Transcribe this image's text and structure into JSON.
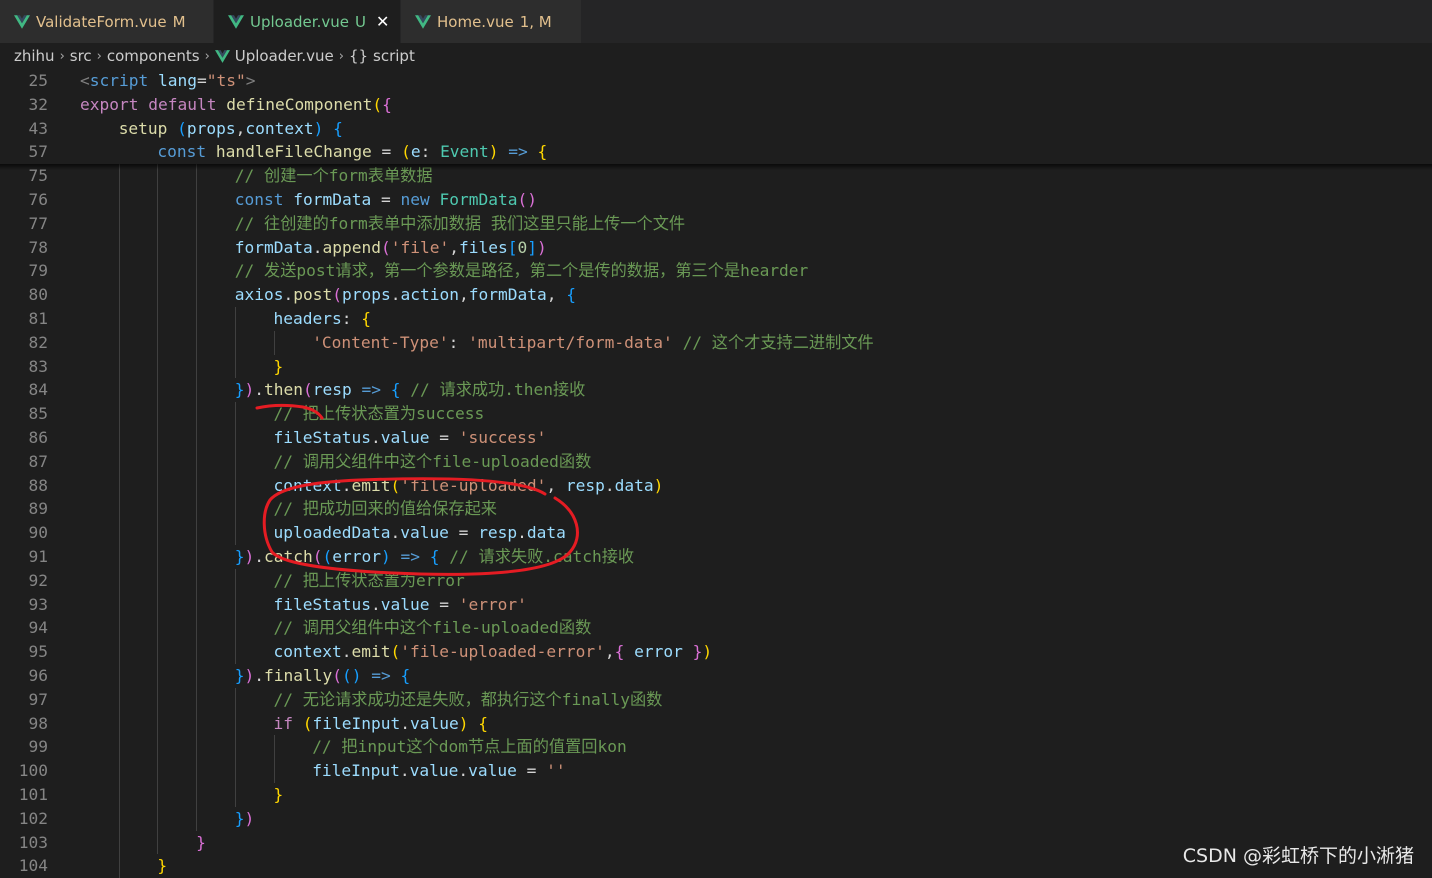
{
  "tabs": [
    {
      "name": "ValidateForm.vue",
      "status": "M",
      "name_color": "#e2c08d",
      "status_color": "#e2c08d",
      "active": false
    },
    {
      "name": "Uploader.vue",
      "status": "U",
      "name_color": "#73c991",
      "status_color": "#73c991",
      "active": true,
      "close": "✕"
    },
    {
      "name": "Home.vue",
      "status": "1, M",
      "name_color": "#e2c08d",
      "status_color": "#e2c08d",
      "active": false
    }
  ],
  "breadcrumb": {
    "items": [
      "zhihu",
      "src",
      "components",
      "Uploader.vue",
      "script"
    ],
    "separator": "›",
    "braces": "{}"
  },
  "sticky_lines": [
    {
      "ln": "25",
      "indent": 0,
      "tokens": [
        [
          "tag",
          "<"
        ],
        [
          "kw",
          "script"
        ],
        [
          "pun",
          " "
        ],
        [
          "var",
          "lang"
        ],
        [
          "pun",
          "="
        ],
        [
          "str",
          "\"ts\""
        ],
        [
          "tag",
          ">"
        ]
      ]
    },
    {
      "ln": "32",
      "indent": 0,
      "tokens": [
        [
          "ctl",
          "export"
        ],
        [
          "pun",
          " "
        ],
        [
          "ctl",
          "default"
        ],
        [
          "pun",
          " "
        ],
        [
          "fn",
          "defineComponent"
        ],
        [
          "b1",
          "("
        ],
        [
          "b2",
          "{"
        ]
      ]
    },
    {
      "ln": "43",
      "indent": 1,
      "tokens": [
        [
          "fn",
          "setup"
        ],
        [
          "pun",
          " "
        ],
        [
          "b3",
          "("
        ],
        [
          "var",
          "props"
        ],
        [
          "pun",
          ","
        ],
        [
          "var",
          "context"
        ],
        [
          "b3",
          ")"
        ],
        [
          "pun",
          " "
        ],
        [
          "b3",
          "{"
        ]
      ]
    },
    {
      "ln": "57",
      "indent": 2,
      "tokens": [
        [
          "kw",
          "const"
        ],
        [
          "pun",
          " "
        ],
        [
          "fn",
          "handleFileChange"
        ],
        [
          "pun",
          " = "
        ],
        [
          "b1",
          "("
        ],
        [
          "var",
          "e"
        ],
        [
          "pun",
          ": "
        ],
        [
          "cls",
          "Event"
        ],
        [
          "b1",
          ")"
        ],
        [
          "pun",
          " "
        ],
        [
          "kw",
          "=>"
        ],
        [
          "pun",
          " "
        ],
        [
          "b1",
          "{"
        ]
      ]
    }
  ],
  "code_lines": [
    {
      "ln": "75",
      "indent": 4,
      "tokens": [
        [
          "cmt",
          "// 创建一个form表单数据"
        ]
      ]
    },
    {
      "ln": "76",
      "indent": 4,
      "tokens": [
        [
          "kw",
          "const"
        ],
        [
          "pun",
          " "
        ],
        [
          "var",
          "formData"
        ],
        [
          "pun",
          " = "
        ],
        [
          "kw",
          "new"
        ],
        [
          "pun",
          " "
        ],
        [
          "cls",
          "FormData"
        ],
        [
          "b2",
          "()"
        ]
      ]
    },
    {
      "ln": "77",
      "indent": 4,
      "tokens": [
        [
          "cmt",
          "// 往创建的form表单中添加数据 我们这里只能上传一个文件"
        ]
      ]
    },
    {
      "ln": "78",
      "indent": 4,
      "tokens": [
        [
          "var",
          "formData"
        ],
        [
          "pun",
          "."
        ],
        [
          "fn",
          "append"
        ],
        [
          "b2",
          "("
        ],
        [
          "str",
          "'file'"
        ],
        [
          "pun",
          ","
        ],
        [
          "var",
          "files"
        ],
        [
          "b3",
          "["
        ],
        [
          "num",
          "0"
        ],
        [
          "b3",
          "]"
        ],
        [
          "b2",
          ")"
        ]
      ]
    },
    {
      "ln": "79",
      "indent": 4,
      "tokens": [
        [
          "cmt",
          "// 发送post请求，第一个参数是路径，第二个是传的数据，第三个是hearder"
        ]
      ]
    },
    {
      "ln": "80",
      "indent": 4,
      "tokens": [
        [
          "var",
          "axios"
        ],
        [
          "pun",
          "."
        ],
        [
          "fn",
          "post"
        ],
        [
          "b2",
          "("
        ],
        [
          "var",
          "props"
        ],
        [
          "pun",
          "."
        ],
        [
          "var",
          "action"
        ],
        [
          "pun",
          ","
        ],
        [
          "var",
          "formData"
        ],
        [
          "pun",
          ", "
        ],
        [
          "b3",
          "{"
        ]
      ]
    },
    {
      "ln": "81",
      "indent": 5,
      "tokens": [
        [
          "var",
          "headers"
        ],
        [
          "pun",
          ": "
        ],
        [
          "b1",
          "{"
        ]
      ]
    },
    {
      "ln": "82",
      "indent": 6,
      "tokens": [
        [
          "str",
          "'Content-Type'"
        ],
        [
          "pun",
          ": "
        ],
        [
          "str",
          "'multipart/form-data'"
        ],
        [
          "pun",
          " "
        ],
        [
          "cmt",
          "// 这个才支持二进制文件"
        ]
      ]
    },
    {
      "ln": "83",
      "indent": 5,
      "tokens": [
        [
          "b1",
          "}"
        ]
      ]
    },
    {
      "ln": "84",
      "indent": 4,
      "tokens": [
        [
          "b3",
          "}"
        ],
        [
          "b2",
          ")"
        ],
        [
          "pun",
          "."
        ],
        [
          "fn",
          "then"
        ],
        [
          "b2",
          "("
        ],
        [
          "var",
          "resp"
        ],
        [
          "pun",
          " "
        ],
        [
          "kw",
          "=>"
        ],
        [
          "pun",
          " "
        ],
        [
          "b3",
          "{"
        ],
        [
          "pun",
          " "
        ],
        [
          "cmt",
          "// 请求成功.then接收"
        ]
      ]
    },
    {
      "ln": "85",
      "indent": 5,
      "tokens": [
        [
          "cmt",
          "// 把上传状态置为success"
        ]
      ]
    },
    {
      "ln": "86",
      "indent": 5,
      "tokens": [
        [
          "var",
          "fileStatus"
        ],
        [
          "pun",
          "."
        ],
        [
          "var",
          "value"
        ],
        [
          "pun",
          " = "
        ],
        [
          "str",
          "'success'"
        ]
      ]
    },
    {
      "ln": "87",
      "indent": 5,
      "tokens": [
        [
          "cmt",
          "// 调用父组件中这个file-uploaded函数"
        ]
      ]
    },
    {
      "ln": "88",
      "indent": 5,
      "tokens": [
        [
          "var",
          "context"
        ],
        [
          "pun",
          "."
        ],
        [
          "fn",
          "emit"
        ],
        [
          "b1",
          "("
        ],
        [
          "str",
          "'file-uploaded'"
        ],
        [
          "pun",
          ", "
        ],
        [
          "var",
          "resp"
        ],
        [
          "pun",
          "."
        ],
        [
          "var",
          "data"
        ],
        [
          "b1",
          ")"
        ]
      ]
    },
    {
      "ln": "89",
      "indent": 5,
      "tokens": [
        [
          "cmt",
          "// 把成功回来的值给保存起来"
        ]
      ]
    },
    {
      "ln": "90",
      "indent": 5,
      "tokens": [
        [
          "var",
          "uploadedData"
        ],
        [
          "pun",
          "."
        ],
        [
          "var",
          "value"
        ],
        [
          "pun",
          " = "
        ],
        [
          "var",
          "resp"
        ],
        [
          "pun",
          "."
        ],
        [
          "var",
          "data"
        ]
      ]
    },
    {
      "ln": "91",
      "indent": 4,
      "tokens": [
        [
          "b3",
          "}"
        ],
        [
          "b2",
          ")"
        ],
        [
          "pun",
          "."
        ],
        [
          "fn",
          "catch"
        ],
        [
          "b2",
          "("
        ],
        [
          "b3",
          "("
        ],
        [
          "var",
          "error"
        ],
        [
          "b3",
          ")"
        ],
        [
          "pun",
          " "
        ],
        [
          "kw",
          "=>"
        ],
        [
          "pun",
          " "
        ],
        [
          "b3",
          "{"
        ],
        [
          "pun",
          " "
        ],
        [
          "cmt",
          "// 请求失败.catch接收"
        ]
      ]
    },
    {
      "ln": "92",
      "indent": 5,
      "tokens": [
        [
          "cmt",
          "// 把上传状态置为error"
        ]
      ]
    },
    {
      "ln": "93",
      "indent": 5,
      "tokens": [
        [
          "var",
          "fileStatus"
        ],
        [
          "pun",
          "."
        ],
        [
          "var",
          "value"
        ],
        [
          "pun",
          " = "
        ],
        [
          "str",
          "'error'"
        ]
      ]
    },
    {
      "ln": "94",
      "indent": 5,
      "tokens": [
        [
          "cmt",
          "// 调用父组件中这个file-uploaded函数"
        ]
      ]
    },
    {
      "ln": "95",
      "indent": 5,
      "tokens": [
        [
          "var",
          "context"
        ],
        [
          "pun",
          "."
        ],
        [
          "fn",
          "emit"
        ],
        [
          "b1",
          "("
        ],
        [
          "str",
          "'file-uploaded-error'"
        ],
        [
          "pun",
          ","
        ],
        [
          "b2",
          "{"
        ],
        [
          "pun",
          " "
        ],
        [
          "var",
          "error"
        ],
        [
          "pun",
          " "
        ],
        [
          "b2",
          "}"
        ],
        [
          "b1",
          ")"
        ]
      ]
    },
    {
      "ln": "96",
      "indent": 4,
      "tokens": [
        [
          "b3",
          "}"
        ],
        [
          "b2",
          ")"
        ],
        [
          "pun",
          "."
        ],
        [
          "fn",
          "finally"
        ],
        [
          "b2",
          "("
        ],
        [
          "b3",
          "()"
        ],
        [
          "pun",
          " "
        ],
        [
          "kw",
          "=>"
        ],
        [
          "pun",
          " "
        ],
        [
          "b3",
          "{"
        ]
      ]
    },
    {
      "ln": "97",
      "indent": 5,
      "tokens": [
        [
          "cmt",
          "// 无论请求成功还是失败，都执行这个finally函数"
        ]
      ]
    },
    {
      "ln": "98",
      "indent": 5,
      "tokens": [
        [
          "ctl",
          "if"
        ],
        [
          "pun",
          " "
        ],
        [
          "b1",
          "("
        ],
        [
          "var",
          "fileInput"
        ],
        [
          "pun",
          "."
        ],
        [
          "var",
          "value"
        ],
        [
          "b1",
          ")"
        ],
        [
          "pun",
          " "
        ],
        [
          "b1",
          "{"
        ]
      ]
    },
    {
      "ln": "99",
      "indent": 6,
      "tokens": [
        [
          "cmt",
          "// 把input这个dom节点上面的值置回kon"
        ]
      ]
    },
    {
      "ln": "100",
      "indent": 6,
      "tokens": [
        [
          "var",
          "fileInput"
        ],
        [
          "pun",
          "."
        ],
        [
          "var",
          "value"
        ],
        [
          "pun",
          "."
        ],
        [
          "var",
          "value"
        ],
        [
          "pun",
          " = "
        ],
        [
          "str",
          "''"
        ]
      ]
    },
    {
      "ln": "101",
      "indent": 5,
      "tokens": [
        [
          "b1",
          "}"
        ]
      ]
    },
    {
      "ln": "102",
      "indent": 4,
      "tokens": [
        [
          "b3",
          "}"
        ],
        [
          "b2",
          ")"
        ]
      ]
    },
    {
      "ln": "103",
      "indent": 3,
      "tokens": [
        [
          "b2",
          "}"
        ]
      ]
    },
    {
      "ln": "104",
      "indent": 2,
      "tokens": [
        [
          "b1",
          "}"
        ]
      ]
    }
  ],
  "watermark": "CSDN @彩虹桥下的小淅猪",
  "colors": {
    "background": "#1e1e1e",
    "tabbar": "#252526",
    "annotation": "#e51c23"
  }
}
